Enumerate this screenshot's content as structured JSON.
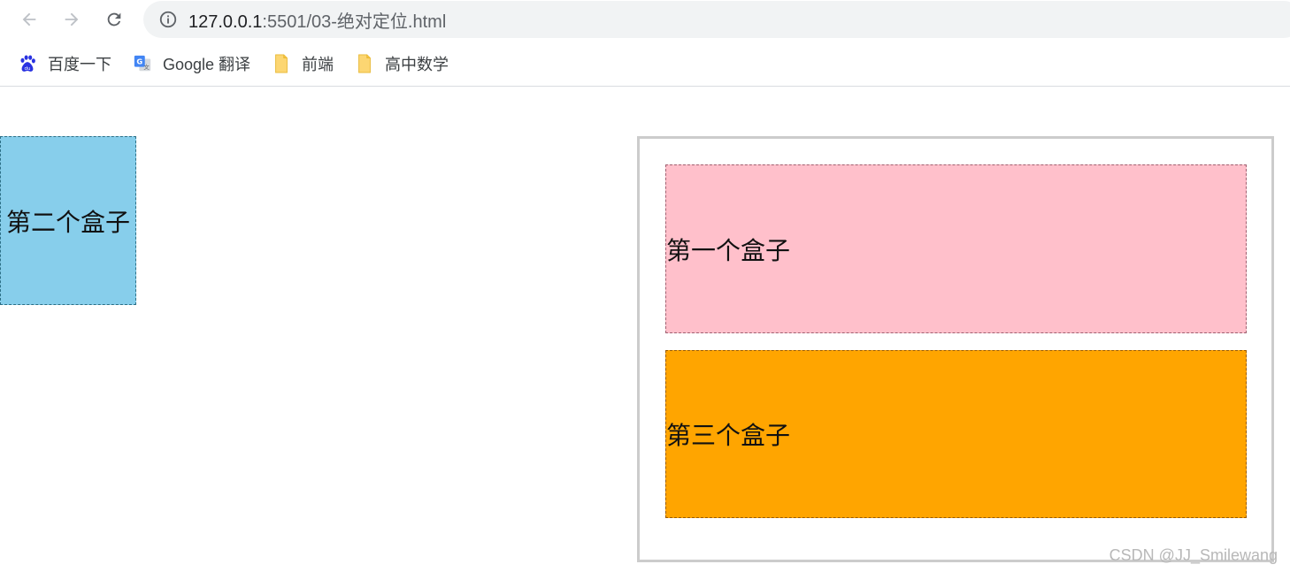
{
  "browser": {
    "url_host": "127.0.0.1",
    "url_path": ":5501/03-绝对定位.html",
    "bookmarks": [
      {
        "label": "百度一下",
        "icon": "baidu-paw-icon",
        "color": "#2932e1"
      },
      {
        "label": "Google 翻译",
        "icon": "google-translate-icon",
        "color": "#4285f4"
      },
      {
        "label": "前端",
        "icon": "folder-icon",
        "color": "#fcd672"
      },
      {
        "label": "高中数学",
        "icon": "folder-icon",
        "color": "#fcd672"
      }
    ]
  },
  "page": {
    "box_second": {
      "label": "第二个盒子",
      "color": "#87ceeb"
    },
    "box_first": {
      "label": "第一个盒子",
      "color": "#ffc0cb"
    },
    "box_third": {
      "label": "第三个盒子",
      "color": "#ffa500"
    },
    "container_border_color": "#cccccc"
  },
  "watermark": "CSDN @JJ_Smilewang"
}
